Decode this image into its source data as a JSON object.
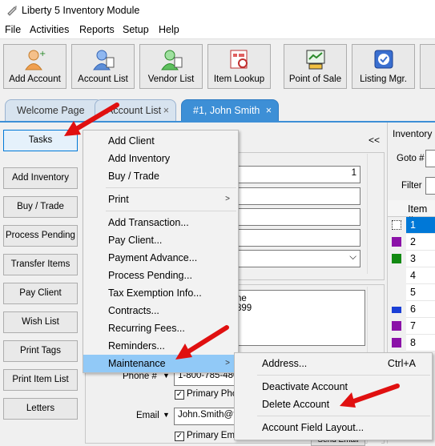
{
  "window": {
    "title": "Liberty 5 Inventory Module"
  },
  "menubar": [
    "File",
    "Activities",
    "Reports",
    "Setup",
    "Help"
  ],
  "toolbar": [
    {
      "label": "Add Account",
      "icon": "add-account-icon"
    },
    {
      "label": "Account List",
      "icon": "account-list-icon"
    },
    {
      "label": "Vendor List",
      "icon": "vendor-list-icon"
    },
    {
      "label": "Item Lookup",
      "icon": "item-lookup-icon"
    },
    {
      "label": "Point of Sale",
      "icon": "point-of-sale-icon"
    },
    {
      "label": "Listing Mgr.",
      "icon": "listing-manager-icon"
    }
  ],
  "tabs": [
    {
      "label": "Welcome Page",
      "close": "×"
    },
    {
      "label": "Account List",
      "close": "×"
    },
    {
      "label": "#1, John Smith",
      "close": "×"
    }
  ],
  "left_buttons": [
    "Tasks",
    "Add Inventory",
    "Buy / Trade",
    "Process Pending",
    "Transfer Items",
    "Pay Client",
    "Wish List",
    "Print Tags",
    "Print Item List",
    "Letters"
  ],
  "center": {
    "collapse": "<<",
    "field_value": "1",
    "address_fragment_1": "ne",
    "address_fragment_2": "899",
    "phone_label": "Phone #",
    "phone_value": "1-800-785-480",
    "primary_phone": "Primary Phon",
    "email_label": "Email",
    "email_value": "John.Smith@fa",
    "primary_email": "Primary Ema",
    "send_email": "Send Email"
  },
  "right_panel": {
    "header": "Inventory",
    "goto": "Goto #",
    "filter": "Filter",
    "col": "Item #",
    "rows": [
      "1",
      "2",
      "3",
      "4",
      "5",
      "6",
      "7",
      "8"
    ]
  },
  "tasks_menu": {
    "group1": [
      "Add Client",
      "Add Inventory",
      "Buy / Trade"
    ],
    "group2": [
      "Print"
    ],
    "group3": [
      "Add Transaction...",
      "Pay Client...",
      "Payment Advance...",
      "Process Pending...",
      "Tax Exemption Info...",
      "Contracts...",
      "Recurring Fees...",
      "Reminders..."
    ],
    "maintenance": "Maintenance",
    "submenu_arrow": ">"
  },
  "maintenance_menu": {
    "address": "Address...",
    "address_shortcut": "Ctrl+A",
    "deactivate": "Deactivate Account",
    "delete": "Delete Account",
    "field_layout": "Account Field Layout..."
  },
  "colors": {
    "accent": "#3d8fd6",
    "highlight": "#91c9f7",
    "arrow": "#e01010",
    "purple": "#8b12a8",
    "green": "#128a12",
    "blue": "#1a3fd6"
  }
}
